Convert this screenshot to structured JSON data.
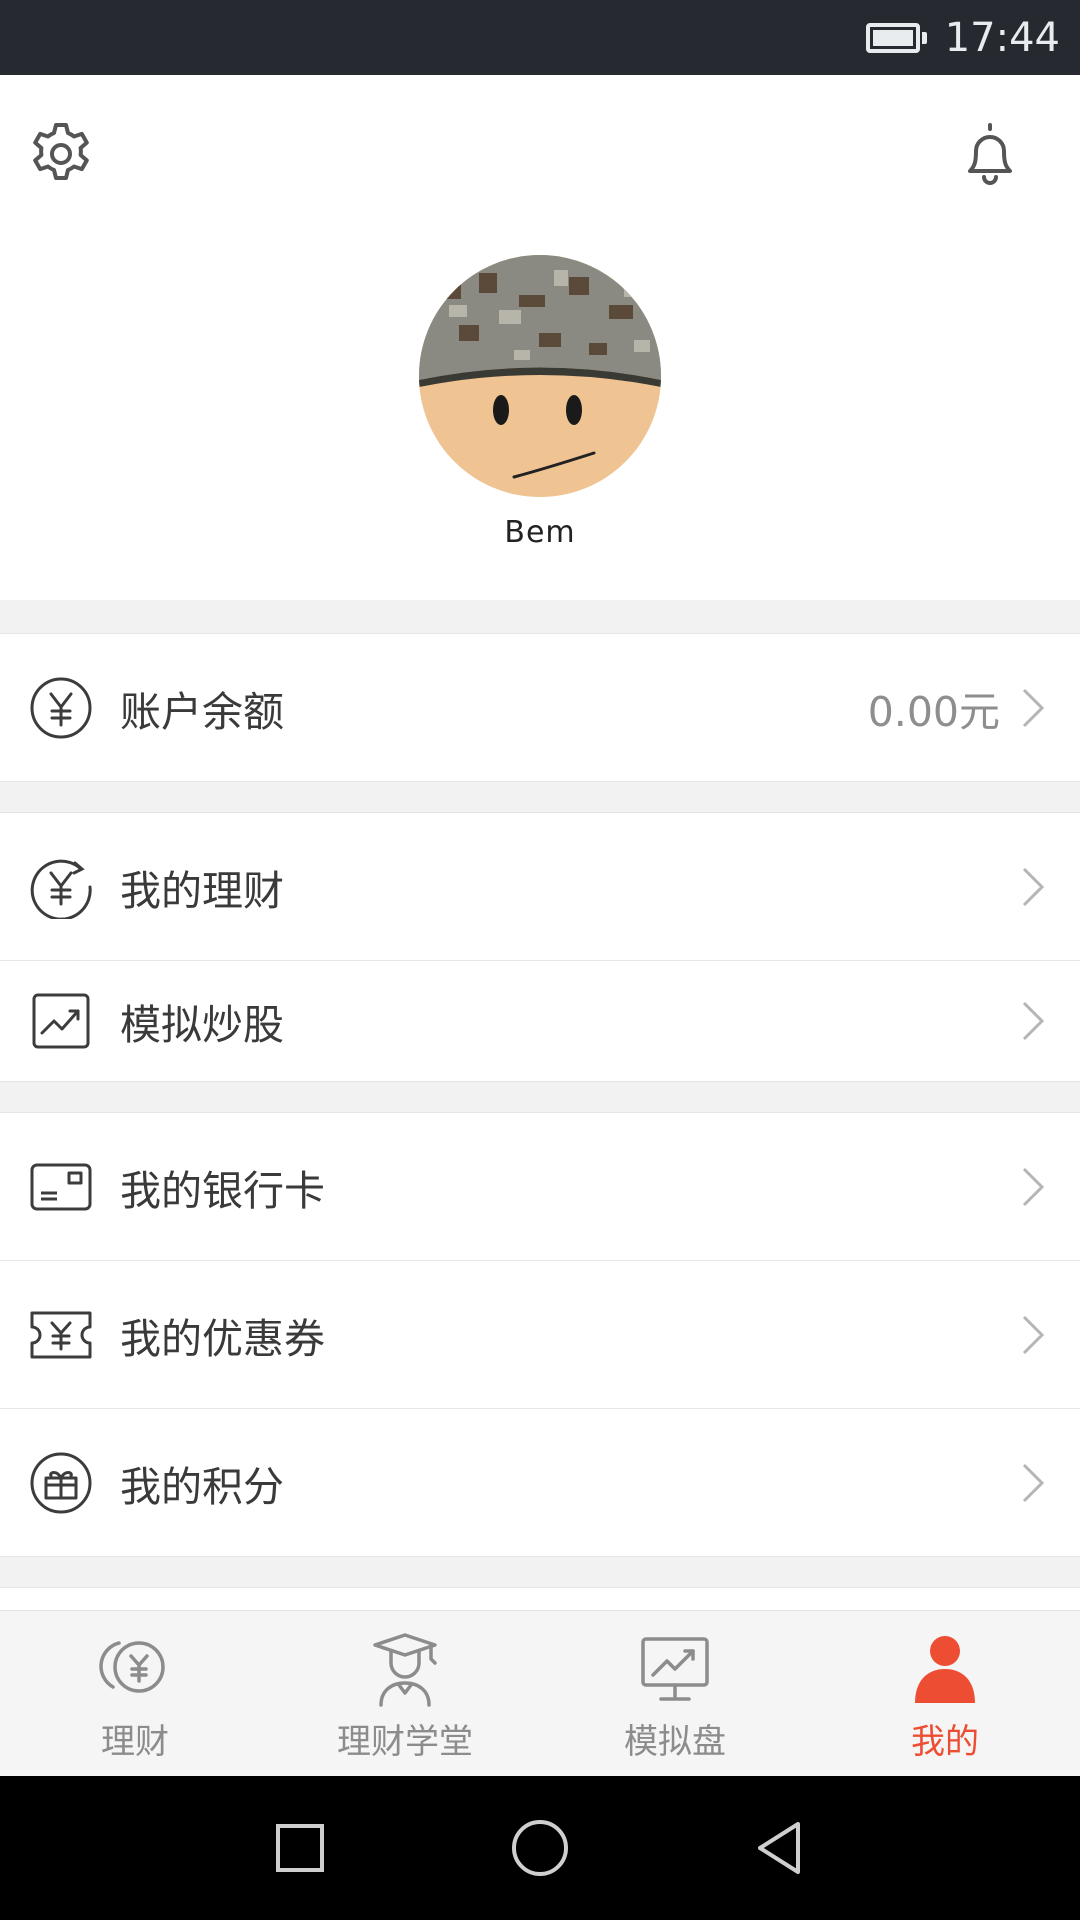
{
  "status_bar": {
    "time": "17:44",
    "battery_icon": "battery-full-icon"
  },
  "header": {
    "settings_icon": "gear-icon",
    "notifications_icon": "bell-icon",
    "username": "Bem"
  },
  "balance_row": {
    "icon": "yuan-circle-icon",
    "label": "账户余额",
    "value": "0.00元"
  },
  "menu_group_1": [
    {
      "icon": "yuan-refresh-icon",
      "label": "我的理财"
    },
    {
      "icon": "stock-chart-icon",
      "label": "模拟炒股"
    }
  ],
  "menu_group_2": [
    {
      "icon": "bank-card-icon",
      "label": "我的银行卡"
    },
    {
      "icon": "coupon-icon",
      "label": "我的优惠券"
    },
    {
      "icon": "gift-icon",
      "label": "我的积分"
    }
  ],
  "tabs": [
    {
      "icon": "finance-coins-icon",
      "label": "理财",
      "active": false
    },
    {
      "icon": "graduate-icon",
      "label": "理财学堂",
      "active": false
    },
    {
      "icon": "monitor-chart-icon",
      "label": "模拟盘",
      "active": false
    },
    {
      "icon": "person-icon",
      "label": "我的",
      "active": true
    }
  ],
  "colors": {
    "accent": "#ed4e33",
    "icon_gray": "#8c8c8c",
    "status_bar": "#262a30"
  }
}
